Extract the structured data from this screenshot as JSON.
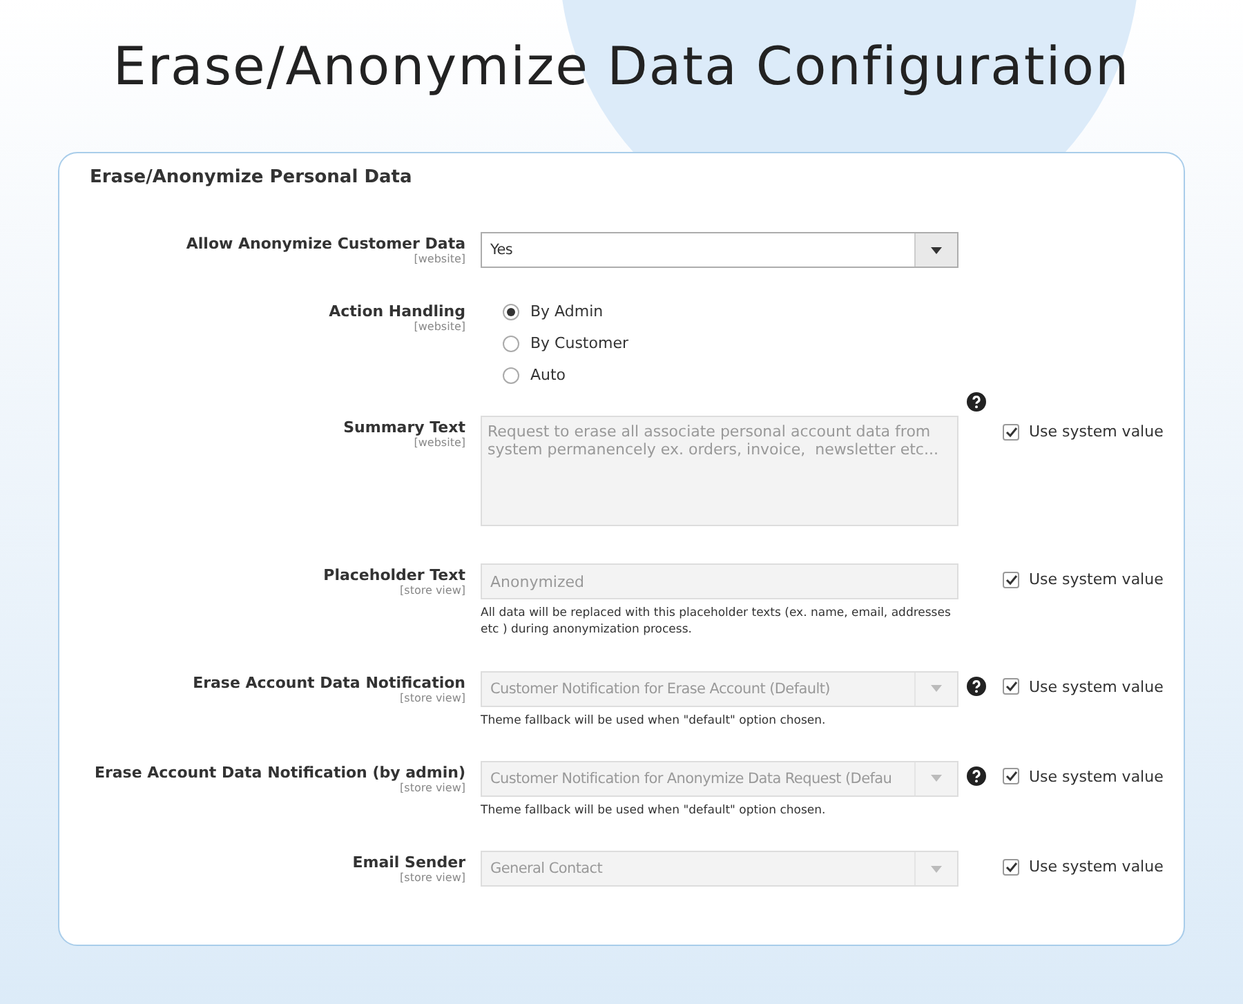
{
  "title": "Erase/Anonymize Data Configuration",
  "section": {
    "title": "Erase/Anonymize Personal Data",
    "fields": [
      {
        "kind": "select",
        "label": "Allow Anonymize Customer Data",
        "scope": "[website]",
        "value": "Yes",
        "disabled": false
      },
      {
        "kind": "radio",
        "label": "Action Handling",
        "scope": "[website]",
        "help": true,
        "options": [
          {
            "label": "By Admin",
            "selected": true
          },
          {
            "label": "By Customer",
            "selected": false
          },
          {
            "label": "Auto",
            "selected": false
          }
        ]
      },
      {
        "kind": "textarea",
        "label": "Summary Text",
        "scope": "[website]",
        "value": "Request to erase all associate personal account data from system permanencely ex. orders, invoice,  newsletter etc...",
        "disabled": true,
        "use_system_value": {
          "label": "Use system value",
          "checked": true
        }
      },
      {
        "kind": "text",
        "label": "Placeholder Text",
        "scope": "[store view]",
        "value": "Anonymized",
        "disabled": true,
        "note": "All data will be replaced with this placeholder texts (ex. name, email, addresses etc ) during anonymization process.",
        "use_system_value": {
          "label": "Use system value",
          "checked": true
        }
      },
      {
        "kind": "select",
        "label": "Erase Account Data Notification",
        "scope": "[store view]",
        "value": "Customer Notification for Erase Account (Default)",
        "disabled": true,
        "help": true,
        "note": "Theme fallback will be used when \"default\" option chosen.",
        "use_system_value": {
          "label": "Use system value",
          "checked": true
        }
      },
      {
        "kind": "select",
        "label": "Erase Account Data Notification (by admin)",
        "scope": "[store view]",
        "value": "Customer Notification for Anonymize Data Request (Defau",
        "disabled": true,
        "help": true,
        "note": "Theme fallback will be used when \"default\" option chosen.",
        "use_system_value": {
          "label": "Use system value",
          "checked": true
        }
      },
      {
        "kind": "select",
        "label": "Email Sender",
        "scope": "[store view]",
        "value": "General Contact",
        "disabled": true,
        "use_system_value": {
          "label": "Use system value",
          "checked": true
        }
      }
    ]
  }
}
